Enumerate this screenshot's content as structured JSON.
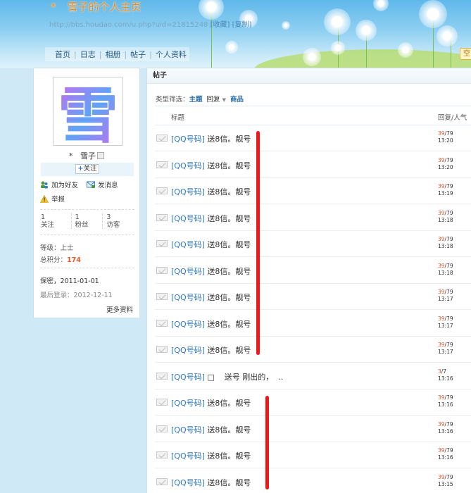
{
  "header": {
    "title_star": "*",
    "title": "雪子的个人主页",
    "url": "http://bbs.houdao.com/u.php?uid=21815248",
    "fav": "[收藏]",
    "copy": "[复制]",
    "corner_btn": "空"
  },
  "nav": {
    "items": [
      "首页",
      "日志",
      "相册",
      "帖子",
      "个人资料"
    ]
  },
  "profile": {
    "avatar_glyph": "雪",
    "star": "*",
    "name": "雪子",
    "follow_plus": "+",
    "follow_label": "关注",
    "add_friend": "加为好友",
    "send_msg": "发消息",
    "report": "举报",
    "stats": [
      {
        "value": "1",
        "label": "关注"
      },
      {
        "value": "1",
        "label": "粉丝"
      },
      {
        "value": "3",
        "label": "访客"
      }
    ],
    "level_label": "等级：",
    "level": "上士",
    "points_label": "总积分：",
    "points": "174",
    "birthday": "保密，2011-01-01",
    "last_login": "最后登录：2012-12-11",
    "more": "更多资料"
  },
  "posts": {
    "section_title": "帖子",
    "filter_label": "类型筛选：",
    "filter_active": "主题",
    "filter_reply": "回复",
    "filter_goods": "商品",
    "col_title": "标题",
    "col_reply": "回复/人气",
    "rows": [
      {
        "tag": "[QQ号码]",
        "text": " 送8信。靓号",
        "replies": "39",
        "views": "/79",
        "time": "13:20"
      },
      {
        "tag": "[QQ号码]",
        "text": " 送8信。靓号",
        "replies": "39",
        "views": "/79",
        "time": "13:20"
      },
      {
        "tag": "[QQ号码]",
        "text": " 送8信。靓号",
        "replies": "39",
        "views": "/79",
        "time": "13:19"
      },
      {
        "tag": "[QQ号码]",
        "text": " 送8信。靓号",
        "replies": "39",
        "views": "/79",
        "time": "13:18"
      },
      {
        "tag": "[QQ号码]",
        "text": " 送8信。靓号",
        "replies": "39",
        "views": "/79",
        "time": "13:18"
      },
      {
        "tag": "[QQ号码]",
        "text": " 送8信。靓号",
        "replies": "39",
        "views": "/79",
        "time": "13:18"
      },
      {
        "tag": "[QQ号码]",
        "text": " 送8信。靓号",
        "replies": "39",
        "views": "/79",
        "time": "13:17"
      },
      {
        "tag": "[QQ号码]",
        "text": " 送8信。靓号",
        "replies": "39",
        "views": "/79",
        "time": "13:17"
      },
      {
        "tag": "[QQ号码]",
        "text": " 送8信。靓号",
        "replies": "39",
        "views": "/79",
        "time": "13:17"
      },
      {
        "tag": "[QQ号码]",
        "text": " □    送号 刚出的，  ..",
        "replies": "3",
        "views": "/7",
        "time": "13:16"
      },
      {
        "tag": "[QQ号码]",
        "text": " 送8信。靓号",
        "replies": "39",
        "views": "/79",
        "time": "13:16"
      },
      {
        "tag": "[QQ号码]",
        "text": " 送8信。靓号",
        "replies": "39",
        "views": "/79",
        "time": "13:16"
      },
      {
        "tag": "[QQ号码]",
        "text": " 送8信。靓号",
        "replies": "39",
        "views": "/79",
        "time": "13:16"
      },
      {
        "tag": "[QQ号码]",
        "text": " 送8信。靓号",
        "replies": "39",
        "views": "/79",
        "time": "13:15"
      }
    ]
  },
  "colors": {
    "accent": "#2e78c2",
    "orange": "#e8572c",
    "annotation_red": "#f21818"
  }
}
